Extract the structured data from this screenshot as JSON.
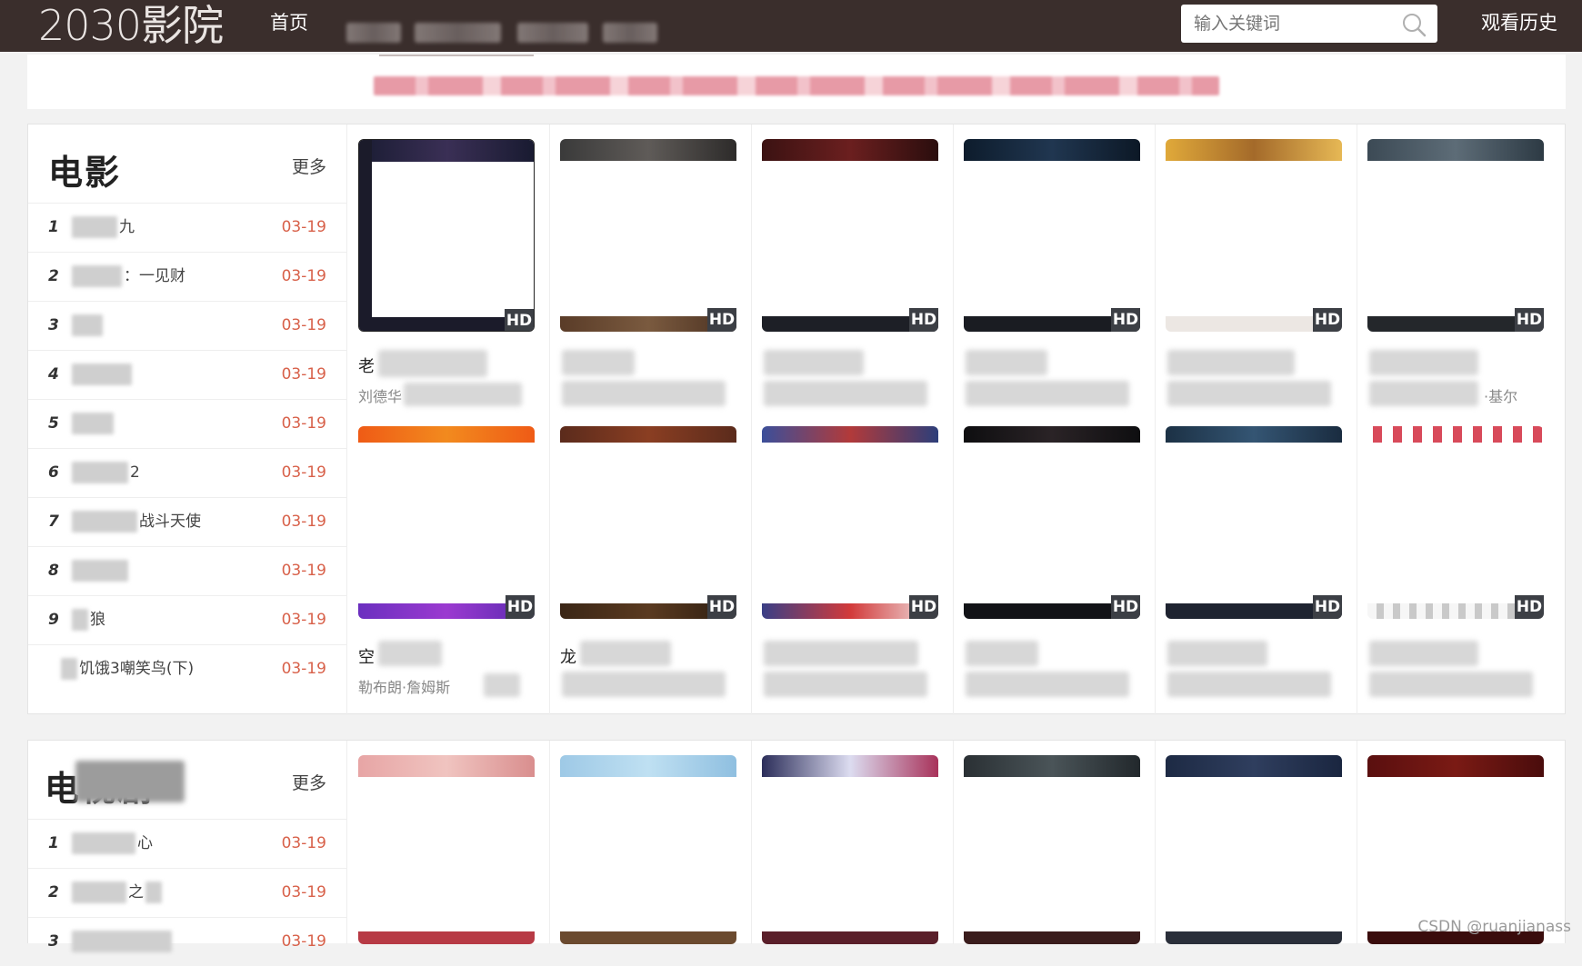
{
  "header": {
    "logo": "2030影院",
    "nav": [
      {
        "label": "首页"
      }
    ],
    "search_placeholder": "输入关键词",
    "history_label": "观看历史"
  },
  "sections": [
    {
      "title": "电影",
      "more": "更多",
      "rank": [
        {
          "num": "1",
          "name": "九",
          "date": "03-19"
        },
        {
          "num": "2",
          "name": "：一见财",
          "date": "03-19"
        },
        {
          "num": "3",
          "name": "",
          "date": "03-19"
        },
        {
          "num": "4",
          "name": "",
          "date": "03-19"
        },
        {
          "num": "5",
          "name": "",
          "date": "03-19"
        },
        {
          "num": "6",
          "name": "2",
          "date": "03-19"
        },
        {
          "num": "7",
          "name": "战斗天使",
          "date": "03-19"
        },
        {
          "num": "8",
          "name": "",
          "date": "03-19"
        },
        {
          "num": "9",
          "name": "狼",
          "date": "03-19"
        },
        {
          "num": "",
          "name": "饥饿3嘲笑鸟(下)",
          "date": "03-19"
        }
      ],
      "cards": [
        {
          "badge": "HD",
          "title": "老",
          "cast": "刘德华"
        },
        {
          "badge": "HD",
          "title": "",
          "cast": ""
        },
        {
          "badge": "HD",
          "title": "",
          "cast": ""
        },
        {
          "badge": "HD",
          "title": "",
          "cast": ""
        },
        {
          "badge": "HD",
          "title": "",
          "cast": ""
        },
        {
          "badge": "HD",
          "title": "",
          "cast": "·基尔"
        },
        {
          "badge": "HD",
          "title": "空",
          "cast": "勒布朗·詹姆斯"
        },
        {
          "badge": "HD",
          "title": "龙",
          "cast": ""
        },
        {
          "badge": "HD",
          "title": "",
          "cast": ""
        },
        {
          "badge": "HD",
          "title": "",
          "cast": ""
        },
        {
          "badge": "HD",
          "title": "",
          "cast": ""
        },
        {
          "badge": "HD",
          "title": "",
          "cast": ""
        }
      ]
    },
    {
      "title": "电视剧",
      "more": "更多",
      "rank": [
        {
          "num": "1",
          "name": "心",
          "date": "03-19"
        },
        {
          "num": "2",
          "name": "之",
          "date": "03-19"
        },
        {
          "num": "3",
          "name": "",
          "date": "03-19"
        }
      ]
    }
  ],
  "watermark": "CSDN @ruanjianass"
}
